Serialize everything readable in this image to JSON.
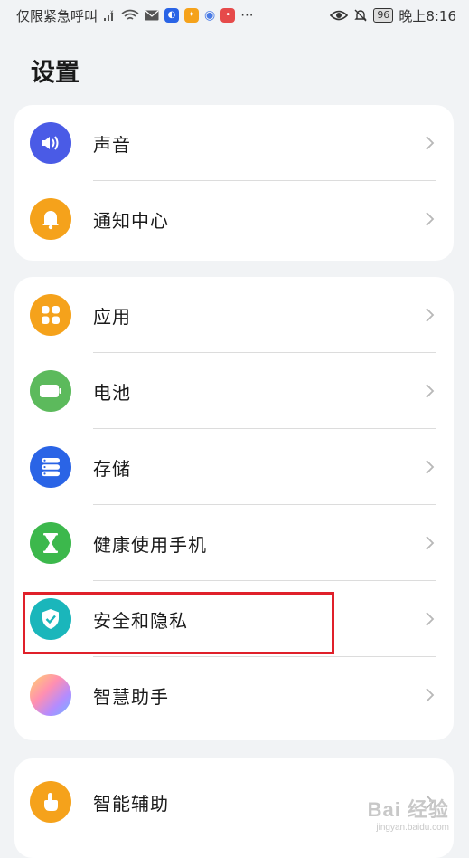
{
  "status_bar": {
    "left_text": "仅限紧急呼叫",
    "battery": "96",
    "time": "晚上8:16",
    "more": "···"
  },
  "page": {
    "title": "设置"
  },
  "groups": [
    {
      "items": [
        {
          "label": "声音",
          "icon": "speaker-icon",
          "color": "#4a5be6"
        },
        {
          "label": "通知中心",
          "icon": "bell-icon",
          "color": "#f5a21b"
        }
      ]
    },
    {
      "items": [
        {
          "label": "应用",
          "icon": "apps-grid-icon",
          "color": "#f5a21b"
        },
        {
          "label": "电池",
          "icon": "battery-icon",
          "color": "#5cba5c"
        },
        {
          "label": "存储",
          "icon": "storage-icon",
          "color": "#2a64e6"
        },
        {
          "label": "健康使用手机",
          "icon": "hourglass-icon",
          "color": "#3cb84c"
        },
        {
          "label": "安全和隐私",
          "icon": "shield-check-icon",
          "color": "#1ab6bb"
        },
        {
          "label": "智慧助手",
          "icon": "smart-assistant-icon",
          "color": "#c38be8"
        }
      ]
    },
    {
      "items": [
        {
          "label": "智能辅助",
          "icon": "hand-tap-icon",
          "color": "#f5a21b"
        }
      ]
    }
  ],
  "watermark": {
    "main": "Bai 经验",
    "sub": "jingyan.baidu.com"
  }
}
